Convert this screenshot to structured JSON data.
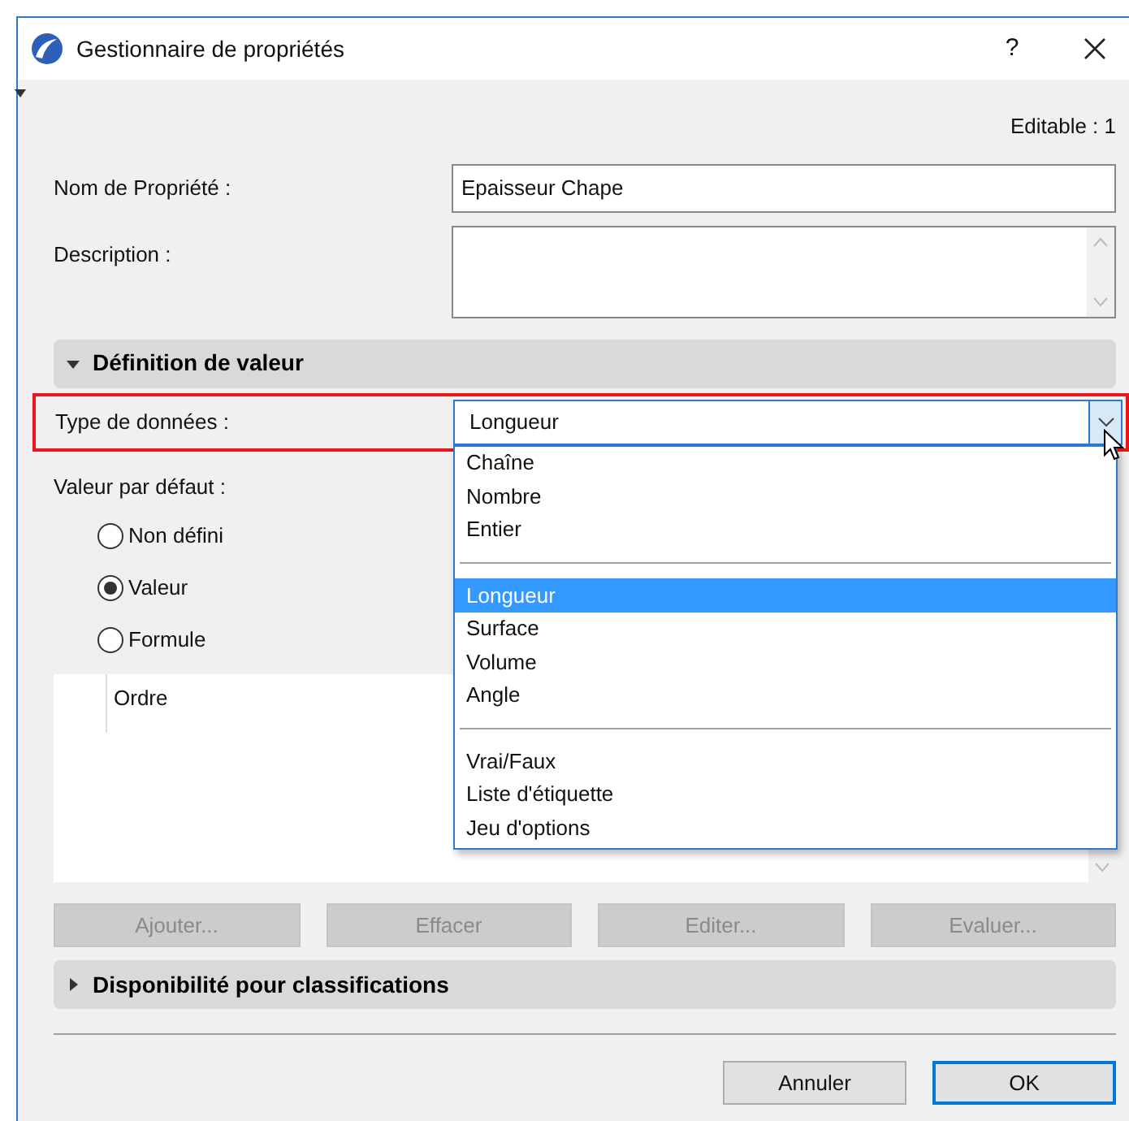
{
  "window": {
    "title": "Gestionnaire de propriétés",
    "help": "?"
  },
  "editable": "Editable : 1",
  "name_field": {
    "label": "Nom de Propriété :",
    "value": "Epaisseur Chape"
  },
  "description_field": {
    "label": "Description :"
  },
  "value_section": {
    "title": "Définition de valeur",
    "expanded": true
  },
  "type_field": {
    "label": "Type de données :",
    "value": "Longueur",
    "highlighted": true,
    "open": true,
    "options": [
      {
        "kind": "item",
        "label": "Chaîne",
        "selected": false
      },
      {
        "kind": "item",
        "label": "Nombre",
        "selected": false
      },
      {
        "kind": "item",
        "label": "Entier",
        "selected": false
      },
      {
        "kind": "separator"
      },
      {
        "kind": "item",
        "label": "Longueur",
        "selected": true
      },
      {
        "kind": "item",
        "label": "Surface",
        "selected": false
      },
      {
        "kind": "item",
        "label": "Volume",
        "selected": false
      },
      {
        "kind": "item",
        "label": "Angle",
        "selected": false
      },
      {
        "kind": "separator"
      },
      {
        "kind": "item",
        "label": "Vrai/Faux",
        "selected": false
      },
      {
        "kind": "item",
        "label": "Liste d'étiquette",
        "selected": false
      },
      {
        "kind": "item",
        "label": "Jeu d'options",
        "selected": false
      }
    ]
  },
  "default_value": {
    "label": "Valeur par défaut :",
    "options": [
      {
        "label": "Non défini",
        "selected": false
      },
      {
        "label": "Valeur",
        "selected": true
      },
      {
        "label": "Formule",
        "selected": false
      }
    ]
  },
  "list": {
    "column": "Ordre"
  },
  "list_buttons": [
    {
      "label": "Ajouter...",
      "disabled": true
    },
    {
      "label": "Effacer",
      "disabled": true
    },
    {
      "label": "Editer...",
      "disabled": true
    },
    {
      "label": "Evaluer...",
      "disabled": true
    }
  ],
  "classification_section": {
    "title": "Disponibilité pour classifications",
    "expanded": false
  },
  "footer_buttons": [
    {
      "label": "Annuler",
      "default": false
    },
    {
      "label": "OK",
      "default": true
    }
  ]
}
